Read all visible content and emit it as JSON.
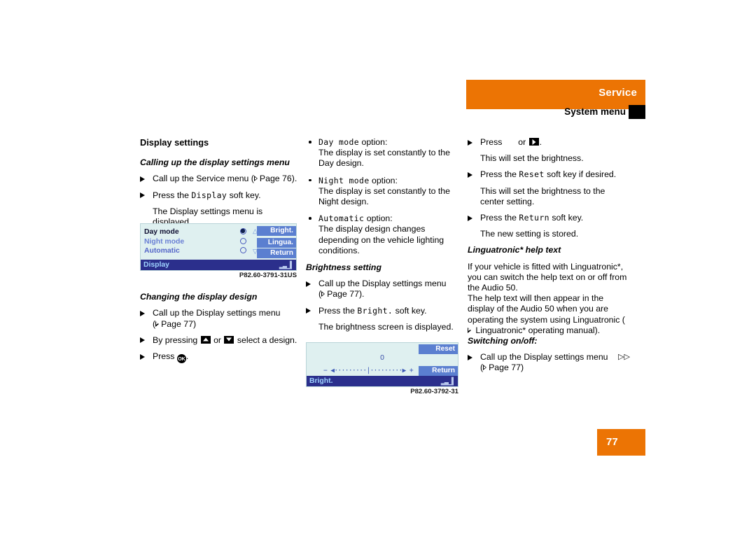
{
  "header": {
    "title": "Service",
    "subtitle": "System menu",
    "accent_color": "#ec7404"
  },
  "left_column": {
    "section_title": "Display settings",
    "sub1_title": "Calling up the display settings menu",
    "sub1_steps": [
      {
        "text_a": "Call up the Service menu (",
        "page": "Page 76",
        "text_b": ")."
      },
      {
        "text_a": "Press the ",
        "mono": "Display",
        "text_b": " soft key."
      }
    ],
    "sub1_note": "The Display settings menu is displayed.",
    "figure1": {
      "options": [
        {
          "label": "Day mode",
          "selected": true
        },
        {
          "label": "Night mode",
          "selected": false
        },
        {
          "label": "Automatic",
          "selected": false
        }
      ],
      "softkeys": [
        "Bright.",
        "Lingua.",
        "Return"
      ],
      "bottom_label": "Display",
      "scroll_up": "△",
      "scroll_down": "▽",
      "caption": "P82.60-3791-31US"
    },
    "sub2_title": "Changing the display design",
    "sub2_steps": [
      {
        "text_a": "Call up the Display settings menu",
        "line2_a": "(",
        "page": "Page 77",
        "line2_b": ")"
      },
      {
        "text_a": "By pressing ",
        "key1": "up-key",
        "text_mid": " or ",
        "key2": "down-key",
        "text_b": " select a design."
      },
      {
        "text_a": "Press ",
        "key1": "ok-key",
        "text_b": "."
      }
    ]
  },
  "middle_column": {
    "options": [
      {
        "mono": "Day mode",
        "suffix": " option:",
        "desc": "The display is set constantly to the Day design."
      },
      {
        "mono": "Night mode",
        "suffix": " option:",
        "desc": "The display is set constantly to the Night design."
      },
      {
        "mono": "Automatic",
        "suffix": " option:",
        "desc": "The display design changes depending on the vehicle lighting conditions."
      }
    ],
    "sub_title": "Brightness setting",
    "steps": [
      {
        "text_a": "Call up the Display settings menu",
        "line2_a": "(",
        "page": "Page 77",
        "line2_b": ")."
      },
      {
        "text_a": "Press the ",
        "mono": "Bright.",
        "text_b": " soft key."
      }
    ],
    "note": "The brightness screen is displayed.",
    "figure2": {
      "value": "0",
      "slider_minus": "−",
      "slider_plus": "+",
      "softkeys": [
        "Reset",
        "Return"
      ],
      "bottom_label": "Bright.",
      "caption": "P82.60-3792-31"
    }
  },
  "right_column": {
    "steps": [
      {
        "text_a": "Press ",
        "key1": "left-key-blank",
        "text_mid": " or ",
        "key2": "right-key",
        "text_b": "."
      },
      {
        "text_a": "Press the ",
        "mono": "Reset",
        "text_b": " soft key if desired."
      },
      {
        "text_a": "Press the ",
        "mono": "Return",
        "text_b": " soft key."
      }
    ],
    "notes": [
      "This will set the brightness.",
      "This will set the brightness to the center setting.",
      "The new setting is stored."
    ],
    "ling_title": "Linguatronic* help text",
    "ling_body_1": "If your vehicle is fitted with Linguatronic*, you can switch the help text on or off from the Audio 50.",
    "ling_body_2": "The help text will then appear in the display of the Audio 50 when you are operating the system using Linguatronic (",
    "ling_body_2b": " Linguatronic* operating manual).",
    "switch_title": "Switching on/off:",
    "switch_step": {
      "text_a": "Call up the Display settings menu",
      "line2_a": "(",
      "page": "Page 77",
      "line2_b": ")"
    },
    "continue_marker": "▷▷"
  },
  "footer": {
    "page_number": "77"
  }
}
